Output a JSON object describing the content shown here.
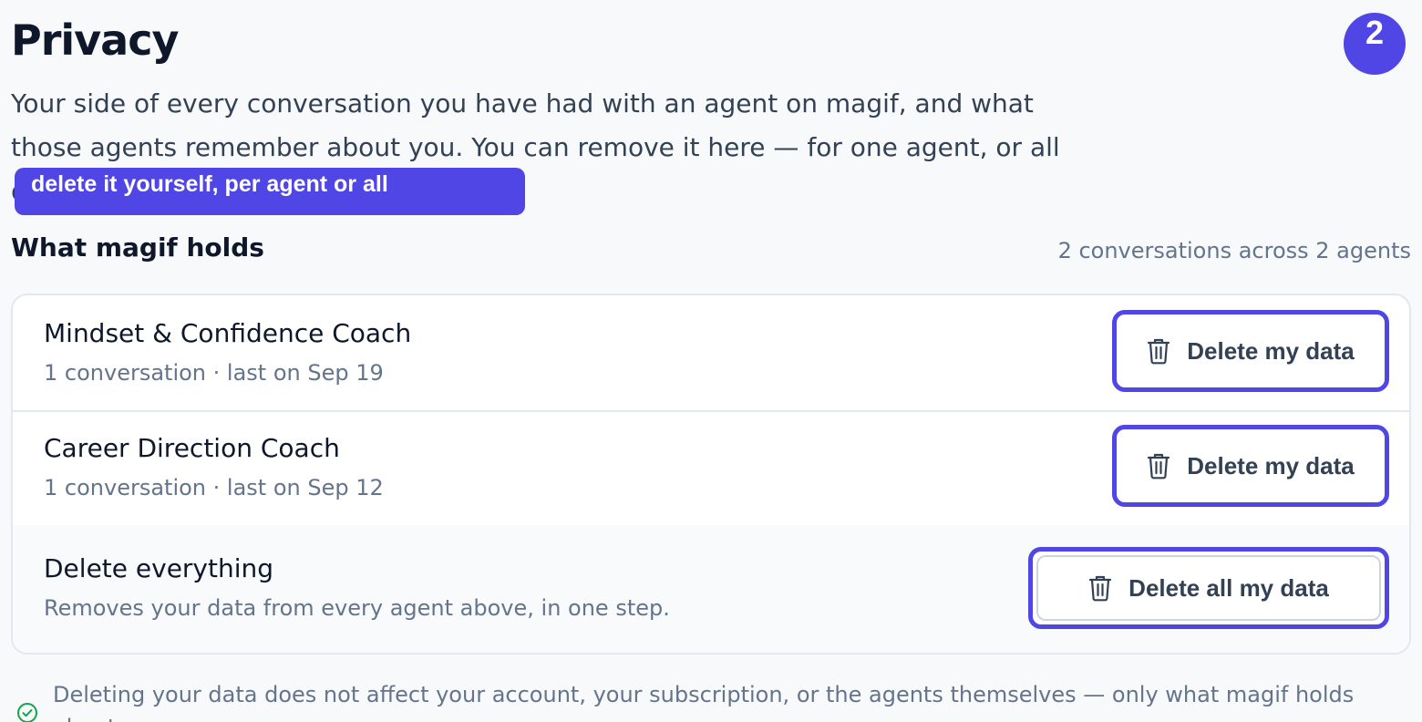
{
  "header": {
    "title": "Privacy",
    "step_badge": "2",
    "intro": "Your side of every conversation you have had with an agent on magif, and what those agents remember about you. You can remove it here — for one agent, or all of it.",
    "callout": "delete it yourself, per agent or all"
  },
  "section": {
    "title": "What magif holds",
    "summary": "2 conversations across 2 agents"
  },
  "agents": [
    {
      "name": "Mindset & Confidence Coach",
      "meta": "1 conversation · last on Sep 19",
      "button_label": "Delete my data",
      "button_icon": "trash-icon"
    },
    {
      "name": "Career Direction Coach",
      "meta": "1 conversation · last on Sep 12",
      "button_label": "Delete my data",
      "button_icon": "trash-icon"
    }
  ],
  "delete_all": {
    "title": "Delete everything",
    "description": "Removes your data from every agent above, in one step.",
    "button_label": "Delete all my data",
    "button_icon": "trash-icon"
  },
  "footnote": {
    "icon": "check-circle-icon",
    "text": "Deleting your data does not affect your account, your subscription, or the agents themselves — only what magif holds about you."
  },
  "colors": {
    "accent": "#4f46e5",
    "text": "#0f172a",
    "muted": "#64748b",
    "success": "#16a34a",
    "border": "#e3e8ef"
  }
}
